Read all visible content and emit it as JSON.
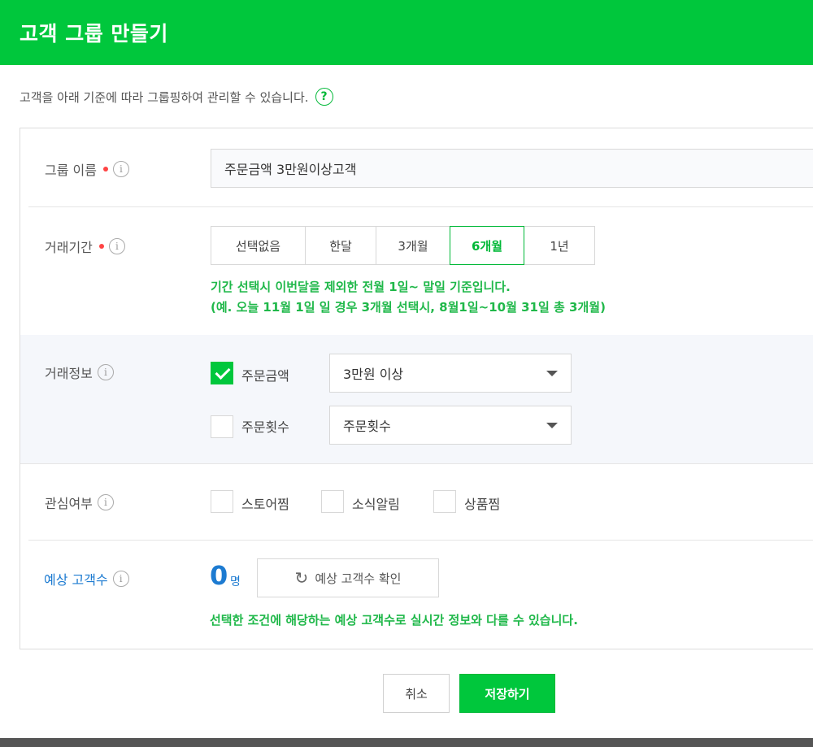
{
  "dialog": {
    "title": "고객 그룹 만들기",
    "description": "고객을 아래 기준에 따라 그룹핑하여 관리할 수 있습니다.",
    "help_glyph": "?"
  },
  "form": {
    "group_name": {
      "label": "그룹 이름",
      "value": "주문금액 3만원이상고객"
    },
    "period": {
      "label": "거래기간",
      "options": [
        "선택없음",
        "한달",
        "3개월",
        "6개월",
        "1년"
      ],
      "selected": "6개월",
      "note_line1": "기간 선택시 이번달을 제외한 전월 1일~ 말일 기준입니다.",
      "note_line2": "(예. 오늘 11월 1일 일 경우 3개월 선택시, 8월1일~10월 31일 총 3개월)"
    },
    "transaction": {
      "label": "거래정보",
      "order_amount": {
        "label": "주문금액",
        "checked": true,
        "select_value": "3만원 이상"
      },
      "order_count": {
        "label": "주문횟수",
        "checked": false,
        "select_value": "주문횟수"
      }
    },
    "interest": {
      "label": "관심여부",
      "options": [
        {
          "label": "스토어찜",
          "checked": false
        },
        {
          "label": "소식알림",
          "checked": false
        },
        {
          "label": "상품찜",
          "checked": false
        }
      ]
    },
    "estimate": {
      "label": "예상 고객수",
      "count": "0",
      "unit": "명",
      "button_label": "예상 고객수 확인",
      "note": "선택한 조건에 해당하는 예상 고객수로 실시간 정보와 다를 수 있습니다."
    },
    "info_glyph": "i"
  },
  "footer": {
    "cancel_label": "취소",
    "save_label": "저장하기"
  },
  "colors": {
    "brand_green": "#00c73c",
    "link_blue": "#1d7bd1",
    "required_red": "#ff4444"
  },
  "icons": {
    "help": "help-icon",
    "info": "info-icon",
    "required": "required-dot-icon",
    "dropdown": "caret-down-icon",
    "refresh": "refresh-icon",
    "check": "check-icon"
  }
}
